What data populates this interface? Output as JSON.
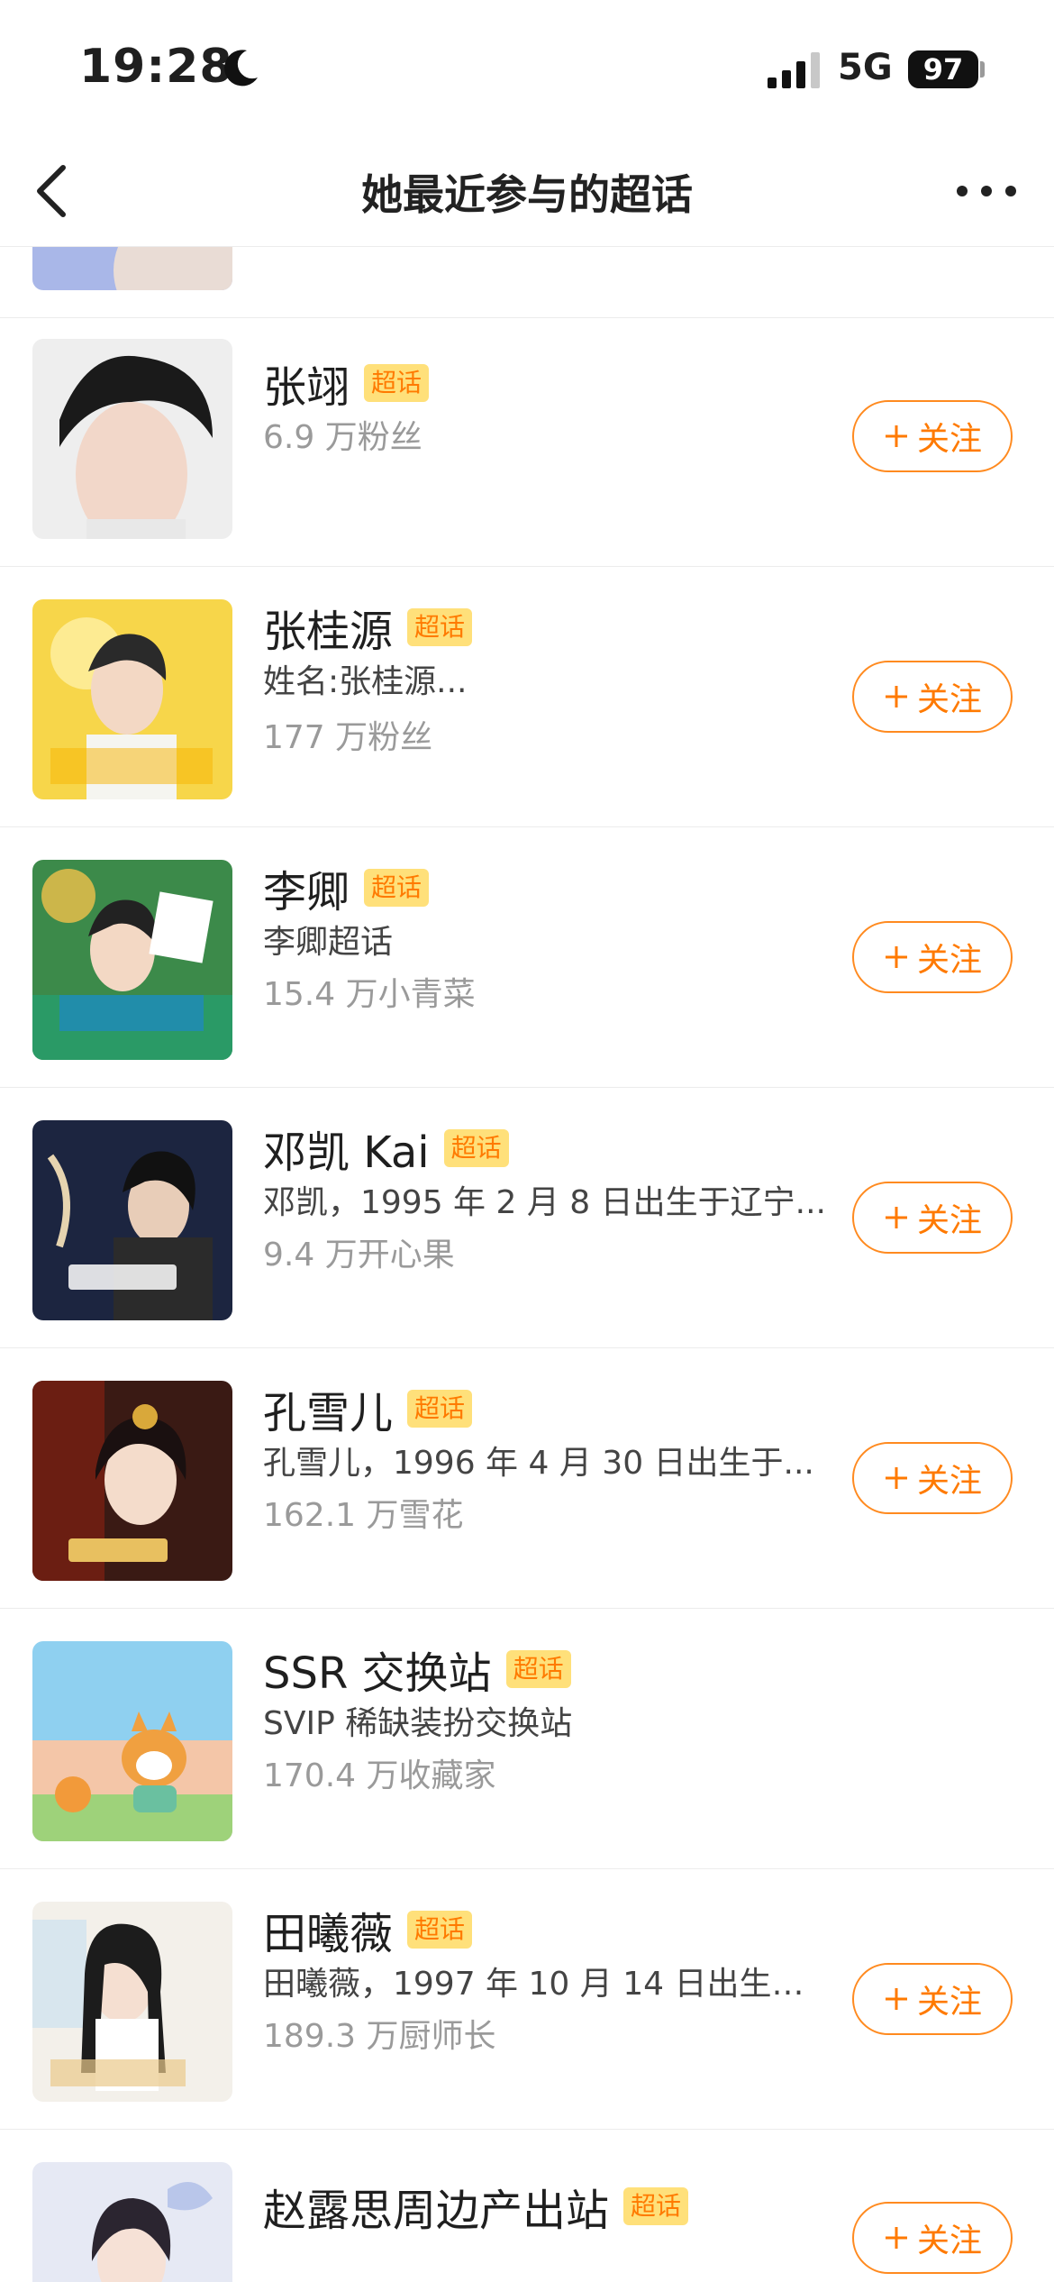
{
  "status": {
    "time": "19:28",
    "network": "5G",
    "battery": "97"
  },
  "nav": {
    "title": "她最近参与的超话"
  },
  "items": [
    {
      "name": "张翊",
      "tag": "超话",
      "desc": "",
      "fans": "6.9 万粉丝",
      "follow": "关注"
    },
    {
      "name": "张桂源",
      "tag": "超话",
      "desc": "姓名:张桂源...",
      "fans": "177 万粉丝",
      "follow": "关注"
    },
    {
      "name": "李卿",
      "tag": "超话",
      "desc": "李卿超话",
      "fans": "15.4 万小青菜",
      "follow": "关注"
    },
    {
      "name": "邓凯 Kai",
      "tag": "超话",
      "desc": "邓凯，1995 年 2 月 8 日出生于辽宁...",
      "fans": "9.4 万开心果",
      "follow": "关注"
    },
    {
      "name": "孔雪儿",
      "tag": "超话",
      "desc": "孔雪儿，1996 年 4 月 30 日出生于...",
      "fans": "162.1 万雪花",
      "follow": "关注"
    },
    {
      "name": "SSR 交换站",
      "tag": "超话",
      "desc": "SVIP 稀缺装扮交换站",
      "fans": "170.4 万收藏家",
      "follow": ""
    },
    {
      "name": "田曦薇",
      "tag": "超话",
      "desc": "田曦薇，1997 年 10 月 14 日出生于...",
      "fans": "189.3 万厨师长",
      "follow": "关注"
    },
    {
      "name": "赵露思周边产出站",
      "tag": "超话",
      "desc": "",
      "fans": "",
      "follow": "关注"
    }
  ],
  "colors": {
    "accent": "#ff7a00",
    "tag_bg": "#ffe07a"
  },
  "icons": {
    "back": "chevron-left-icon",
    "more": "more-dots-icon",
    "plus": "plus-icon",
    "moon": "moon-icon",
    "signal": "signal-icon"
  }
}
